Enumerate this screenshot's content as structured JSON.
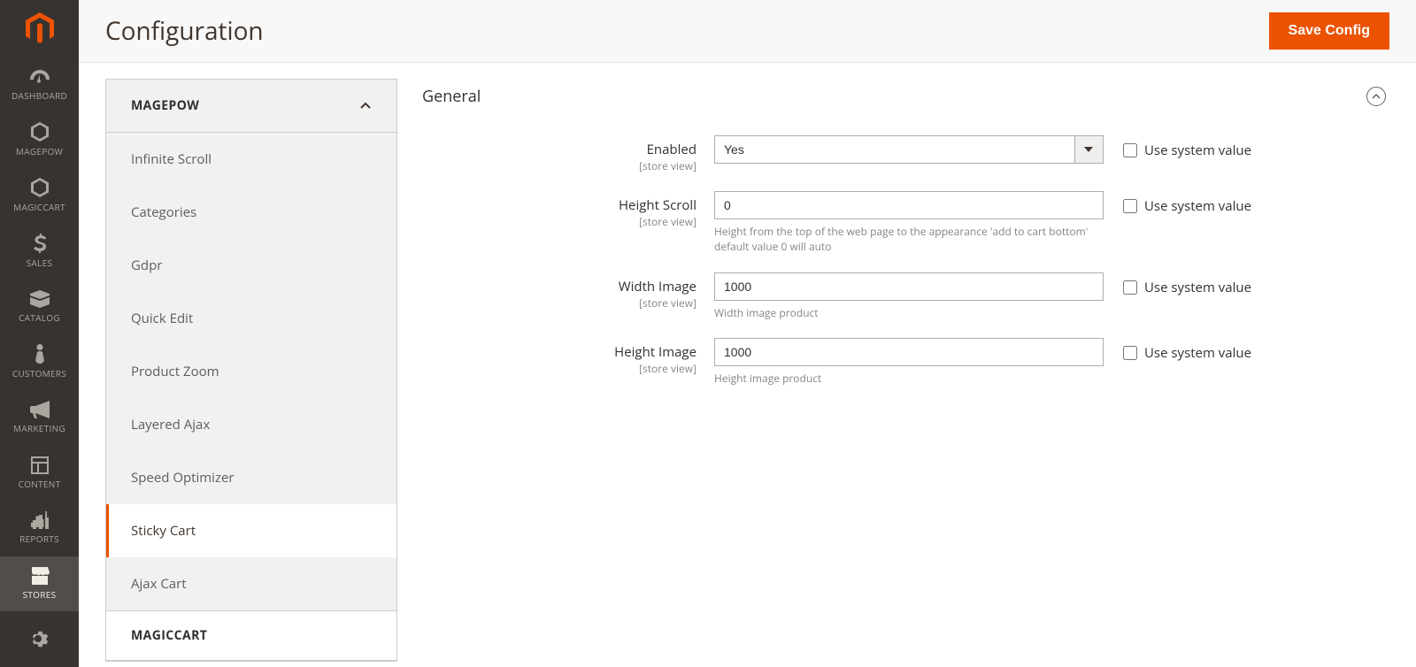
{
  "leftnav": {
    "items": [
      {
        "label": "DASHBOARD"
      },
      {
        "label": "MAGEPOW"
      },
      {
        "label": "MAGICCART"
      },
      {
        "label": "SALES"
      },
      {
        "label": "CATALOG"
      },
      {
        "label": "CUSTOMERS"
      },
      {
        "label": "MARKETING"
      },
      {
        "label": "CONTENT"
      },
      {
        "label": "REPORTS"
      },
      {
        "label": "STORES"
      }
    ]
  },
  "header": {
    "title": "Configuration",
    "save_label": "Save Config"
  },
  "config_nav": {
    "group_label": "MAGEPOW",
    "items": [
      {
        "label": "Infinite Scroll"
      },
      {
        "label": "Categories"
      },
      {
        "label": "Gdpr"
      },
      {
        "label": "Quick Edit"
      },
      {
        "label": "Product Zoom"
      },
      {
        "label": "Layered Ajax"
      },
      {
        "label": "Speed Optimizer"
      },
      {
        "label": "Sticky Cart"
      },
      {
        "label": "Ajax Cart"
      }
    ],
    "next_group_label": "MAGICCART"
  },
  "section": {
    "title": "General",
    "scope_text": "[store view]",
    "use_system_label": "Use system value",
    "fields": {
      "enabled": {
        "label": "Enabled",
        "value": "Yes"
      },
      "height_scroll": {
        "label": "Height Scroll",
        "value": "0",
        "hint": "Height from the top of the web page to the appearance 'add to cart bottom' default value 0 will auto"
      },
      "width_image": {
        "label": "Width Image",
        "value": "1000",
        "hint": "Width image product"
      },
      "height_image": {
        "label": "Height Image",
        "value": "1000",
        "hint": "Height image product"
      }
    }
  }
}
